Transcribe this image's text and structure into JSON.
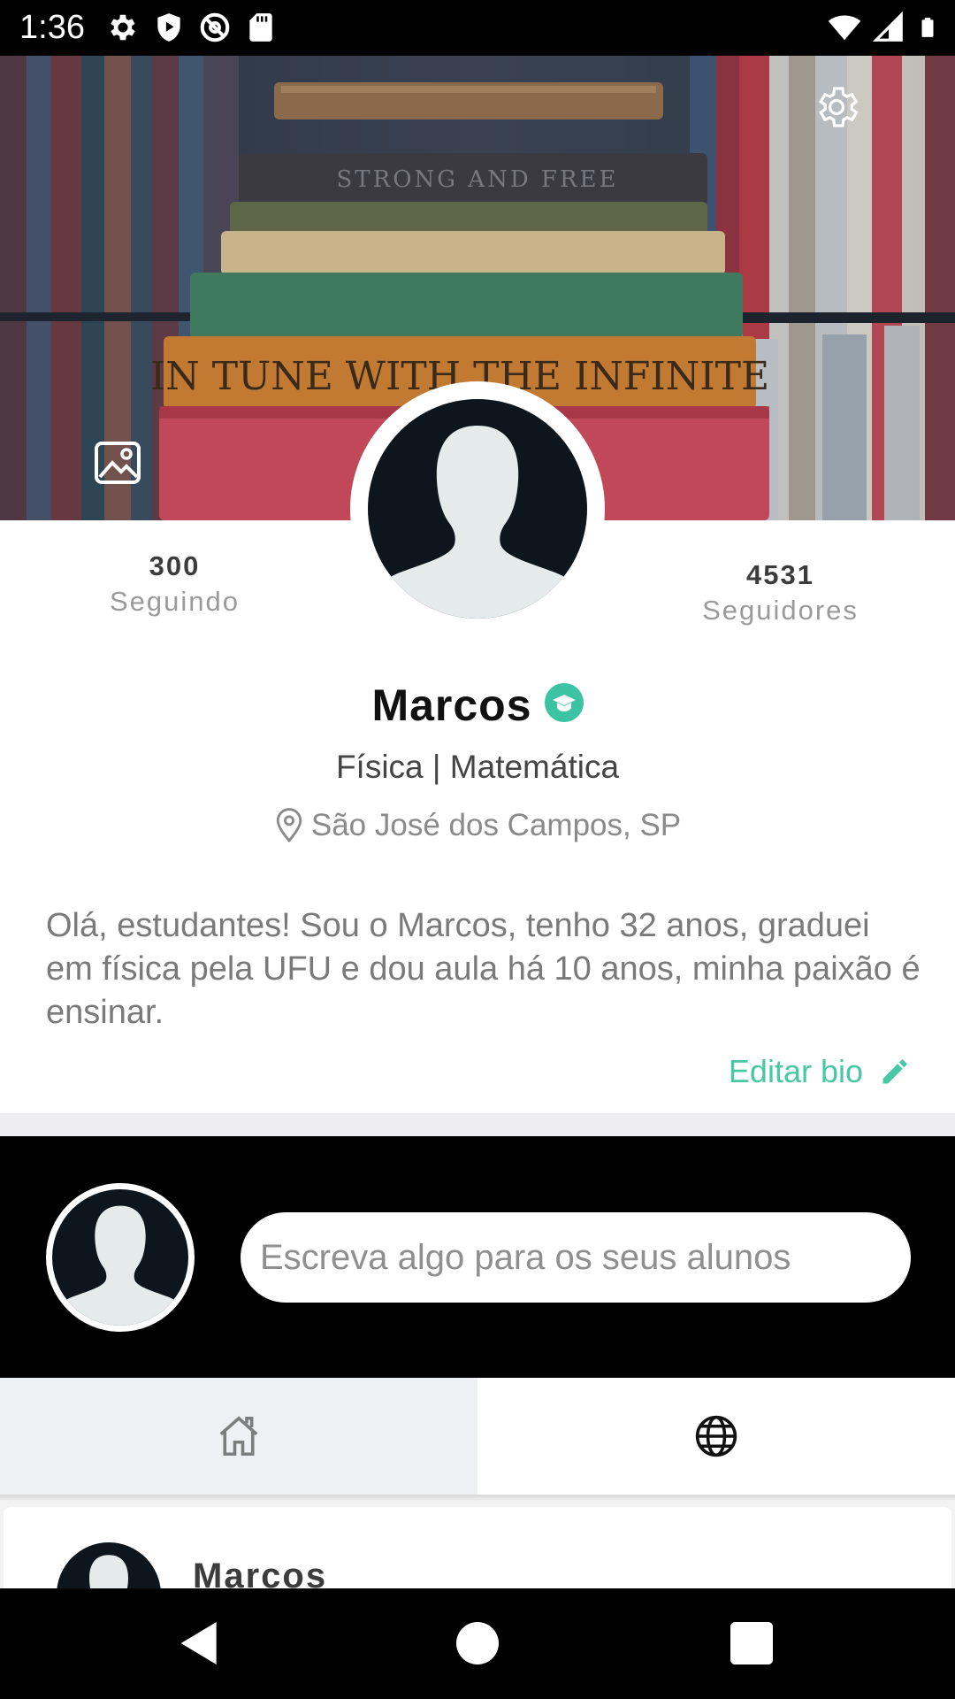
{
  "status_bar": {
    "time": "1:36",
    "left_icons": [
      "settings-icon",
      "play-protect-icon",
      "at-sign-icon",
      "sd-card-icon"
    ],
    "right_icons": [
      "wifi-icon",
      "cell-signal-icon",
      "battery-icon"
    ]
  },
  "cover": {
    "book_spine_text": [
      "STRONG AND FREE",
      "IN TUNE WITH THE INFINITE"
    ],
    "settings_icon": "gear-icon",
    "change_cover_icon": "image-icon"
  },
  "stats": {
    "following": {
      "count": "300",
      "label": "Seguindo"
    },
    "followers": {
      "count": "4531",
      "label": "Seguidores"
    }
  },
  "profile": {
    "name": "Marcos",
    "verified_icon": "graduation-cap-badge-icon",
    "subjects": "Física | Matemática",
    "location": "São José dos Campos, SP",
    "bio": "Olá, estudantes! Sou o Marcos, tenho 32 anos, graduei em física pela UFU e dou aula há 10 anos, minha paixão é ensinar.",
    "edit_bio_label": "Editar bio"
  },
  "composer": {
    "placeholder": "Escreva algo para os seus alunos"
  },
  "tabs": [
    {
      "icon": "home-icon",
      "selected": true
    },
    {
      "icon": "globe-icon",
      "selected": false
    }
  ],
  "feed": {
    "posts": [
      {
        "author": "Marcos"
      }
    ]
  },
  "colors": {
    "accent": "#47c7a4",
    "avatar_dark": "#0d161d",
    "avatar_silhouette": "#e5eaeb"
  }
}
